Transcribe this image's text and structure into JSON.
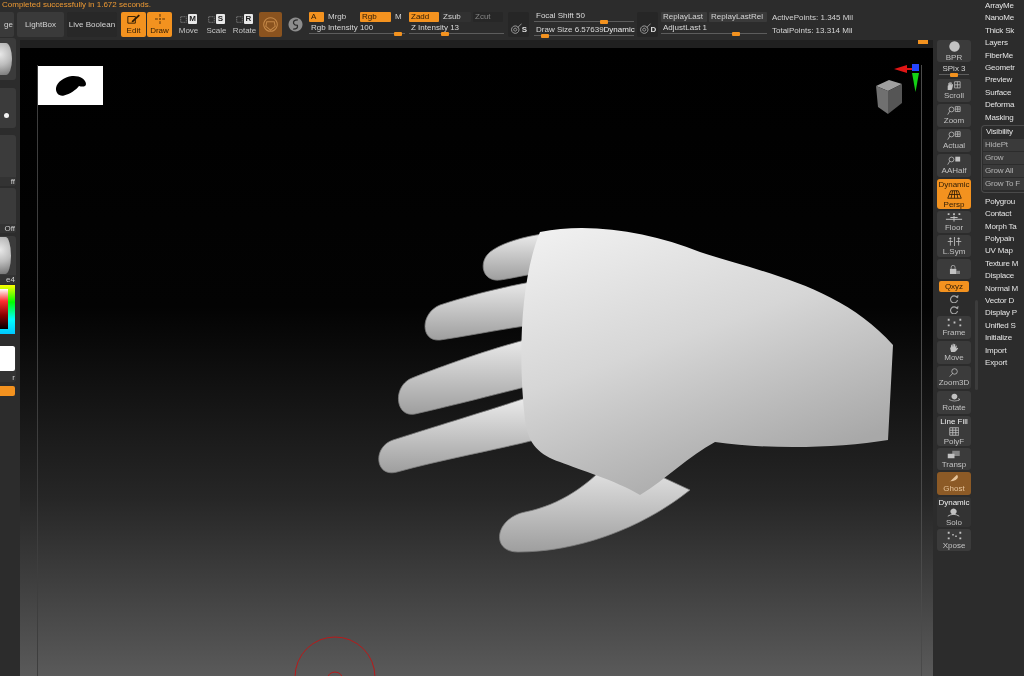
{
  "status": {
    "message": "Completed successfully in 1.672 seconds."
  },
  "toolbar": {
    "buttons": [
      {
        "label": "ge"
      },
      {
        "label": "LightBox"
      },
      {
        "label": "Live Boolean"
      }
    ],
    "transform_tools": [
      {
        "kind": "edit",
        "label": "Edit",
        "selected": true
      },
      {
        "kind": "draw",
        "label": "Draw",
        "selected": true
      },
      {
        "kind": "move",
        "label": "Move",
        "key": "M",
        "selected": false
      },
      {
        "kind": "scale",
        "label": "Scale",
        "key": "S",
        "selected": false
      },
      {
        "kind": "rotate",
        "label": "Rotate",
        "key": "R",
        "selected": false
      }
    ],
    "quick_buttons": [
      {
        "kind": "material",
        "selected": true
      },
      {
        "kind": "swirl",
        "selected": false
      }
    ],
    "color_modes": [
      {
        "label": "A",
        "selected": true
      },
      {
        "label": "Mrgb",
        "selected": false
      },
      {
        "label": "Rgb",
        "selected": true
      },
      {
        "label": "M",
        "selected": false
      }
    ],
    "rgb_intensity": {
      "label": "Rgb Intensity 100",
      "level": 0.97
    },
    "z_modes": [
      {
        "label": "Zadd",
        "selected": true,
        "disabled": false
      },
      {
        "label": "Zsub",
        "selected": false,
        "disabled": false
      },
      {
        "label": "Zcut",
        "selected": false,
        "disabled": true
      }
    ],
    "z_intensity": {
      "label": "Z Intensity 13",
      "level": 0.37
    },
    "stroke_button": {
      "key": "S"
    },
    "focal_shift": {
      "label": "Focal Shift 50",
      "level": 0.72
    },
    "draw_size": {
      "label": "Draw Size 6.57639",
      "mode": "Dynamic",
      "level": 0.08
    },
    "alpha_button": {
      "key": "D"
    },
    "replay_buttons": [
      {
        "label": "ReplayLast"
      },
      {
        "label": "ReplayLastRel"
      }
    ],
    "adjust_last": {
      "label": "AdjustLast 1",
      "level": 0.72
    },
    "stats": [
      {
        "label": "ActivePoints: 1.345 Mil"
      },
      {
        "label": "TotalPoints: 13.314 Mil"
      }
    ]
  },
  "left_shelf": [
    {
      "kind": "sphere"
    },
    {
      "kind": "dot"
    },
    {
      "kind": "panel",
      "caption": "ff"
    },
    {
      "kind": "panel",
      "caption": "Off"
    },
    {
      "kind": "material",
      "caption": "e4"
    },
    {
      "kind": "color"
    },
    {
      "kind": "swatch",
      "caption": "r"
    },
    {
      "kind": "bar"
    }
  ],
  "right_shelf": [
    {
      "kind": "bpr",
      "label": "BPR",
      "selected": false
    },
    {
      "kind": "slider",
      "label": "SPix 3",
      "level": 0.5
    },
    {
      "kind": "scroll",
      "label": "Scroll",
      "selected": false
    },
    {
      "kind": "zoom",
      "label": "Zoom",
      "selected": false
    },
    {
      "kind": "actual",
      "label": "Actual",
      "selected": false
    },
    {
      "kind": "aahalf",
      "label": "AAHalf",
      "selected": false
    },
    {
      "kind": "persp",
      "label": "Persp",
      "caption": "Dynamic",
      "selected": true
    },
    {
      "kind": "floor",
      "label": "Floor",
      "selected": false
    },
    {
      "kind": "lsym",
      "label": "L.Sym",
      "selected": false
    },
    {
      "kind": "lock",
      "selected": false
    },
    {
      "kind": "toggle",
      "label": "Qxyz",
      "selected": true
    },
    {
      "kind": "mini"
    },
    {
      "kind": "mini"
    },
    {
      "kind": "frame",
      "label": "Frame",
      "selected": false
    },
    {
      "kind": "move",
      "label": "Move",
      "selected": false
    },
    {
      "kind": "zoom3d",
      "label": "Zoom3D",
      "selected": false
    },
    {
      "kind": "rotate",
      "label": "Rotate",
      "selected": false
    },
    {
      "kind": "polyf",
      "label": "PolyF",
      "caption": "Line Fill",
      "selected": false
    },
    {
      "kind": "transp",
      "label": "Transp",
      "selected": false
    },
    {
      "kind": "ghost",
      "label": "Ghost",
      "selected": true
    },
    {
      "kind": "solo",
      "label": "Solo",
      "caption": "Dynamic",
      "selected": false
    },
    {
      "kind": "xpose",
      "label": "Xpose",
      "selected": false
    }
  ],
  "menu": [
    {
      "label": "ArrayMe",
      "expanded": false
    },
    {
      "label": "NanoMe",
      "expanded": false
    },
    {
      "label": "Thick Sk",
      "expanded": false
    },
    {
      "label": "Layers",
      "expanded": false
    },
    {
      "label": "FiberMe",
      "expanded": false
    },
    {
      "label": "Geometr",
      "expanded": false
    },
    {
      "label": "Preview",
      "expanded": false
    },
    {
      "label": "Surface",
      "expanded": false
    },
    {
      "label": "Deforma",
      "expanded": false
    },
    {
      "label": "Masking",
      "expanded": false
    },
    {
      "label": "Visibility",
      "expanded": true,
      "children": [
        {
          "label": "HidePt"
        },
        {
          "label": "Grow"
        },
        {
          "label": "Grow All"
        },
        {
          "label": "Grow To F"
        }
      ]
    },
    {
      "label": "Polygrou",
      "expanded": false
    },
    {
      "label": "Contact",
      "expanded": false
    },
    {
      "label": "Morph Ta",
      "expanded": false
    },
    {
      "label": "Polypain",
      "expanded": false
    },
    {
      "label": "UV Map",
      "expanded": false
    },
    {
      "label": "Texture M",
      "expanded": false
    },
    {
      "label": "Displace",
      "expanded": false
    },
    {
      "label": "Normal M",
      "expanded": false
    },
    {
      "label": "Vector D",
      "expanded": false
    },
    {
      "label": "Display P",
      "expanded": false
    },
    {
      "label": "Unified S",
      "expanded": false
    },
    {
      "label": "Initialize",
      "expanded": false
    },
    {
      "label": "Import",
      "expanded": false
    },
    {
      "label": "Export",
      "expanded": false
    }
  ]
}
